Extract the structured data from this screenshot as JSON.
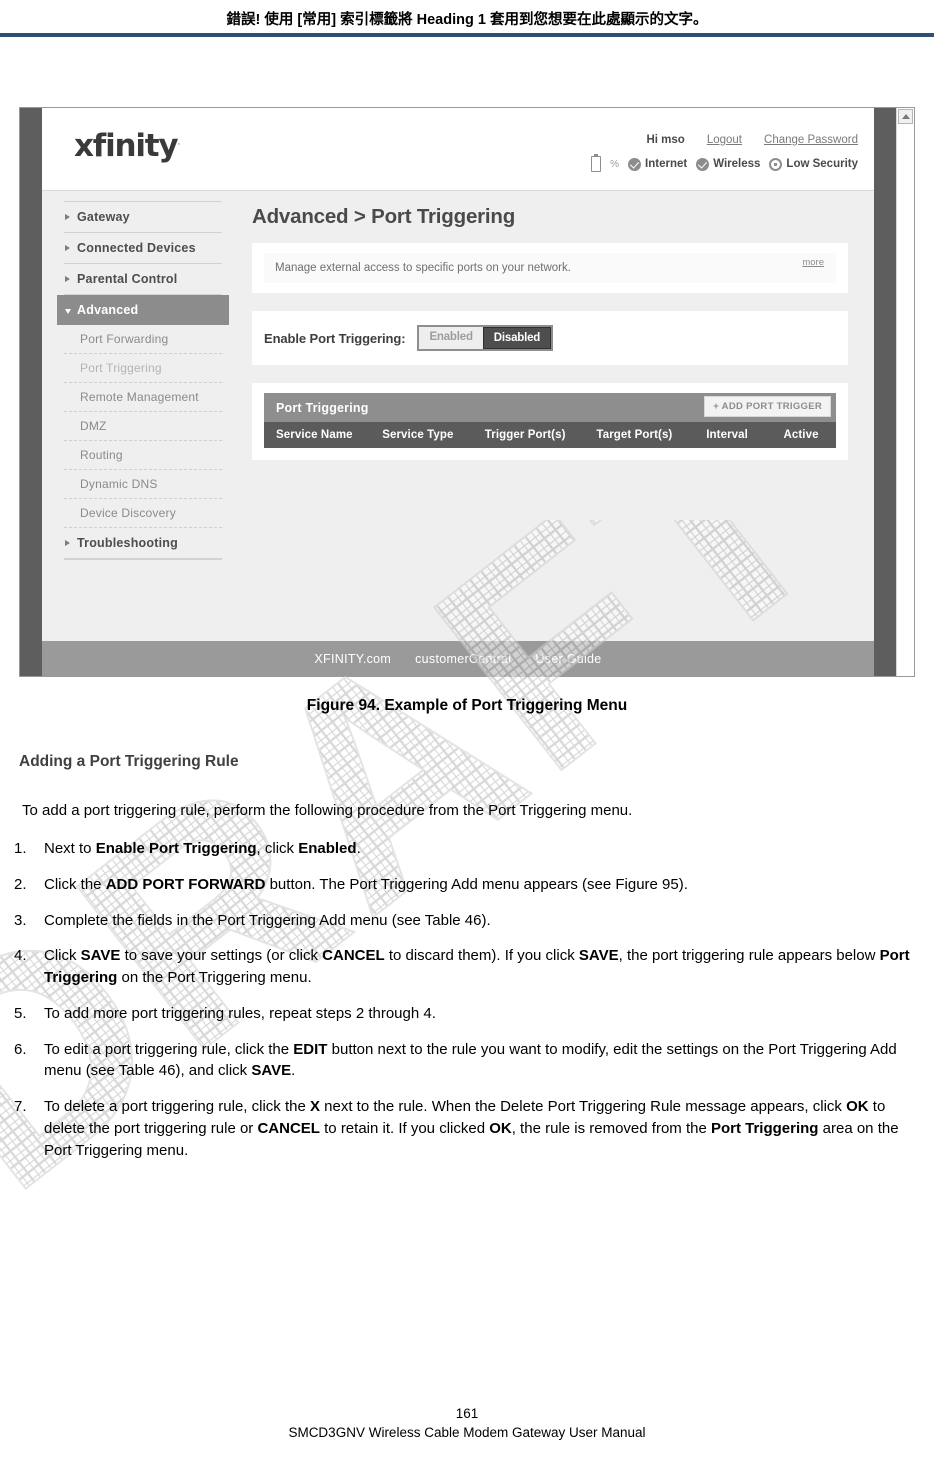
{
  "page_head": {
    "text": "錯誤! 使用 [常用] 索引標籤將 Heading 1 套用到您想要在此處顯示的文字。",
    "rule_color": "#2e5074"
  },
  "watermark": {
    "text": "DRAFT"
  },
  "figure": {
    "caption": "Figure 94. Example of Port Triggering Menu",
    "router_ui": {
      "brand": {
        "logo": "xfinity",
        "tm": "."
      },
      "header": {
        "greeting": "Hi mso",
        "logout": "Logout",
        "change_password": "Change Password",
        "battery_pct": "%",
        "status": [
          {
            "icon": "check-circle-icon",
            "label": "Internet"
          },
          {
            "icon": "check-circle-icon",
            "label": "Wireless"
          },
          {
            "icon": "shield-icon",
            "label": "Low Security"
          }
        ]
      },
      "nav": {
        "items": [
          {
            "label": "Gateway",
            "type": "top",
            "state": "collapsed"
          },
          {
            "label": "Connected Devices",
            "type": "top",
            "state": "collapsed"
          },
          {
            "label": "Parental Control",
            "type": "top",
            "state": "collapsed"
          },
          {
            "label": "Advanced",
            "type": "top",
            "state": "expanded-active"
          },
          {
            "label": "Port Forwarding",
            "type": "sub",
            "state": "normal"
          },
          {
            "label": "Port Triggering",
            "type": "sub",
            "state": "current"
          },
          {
            "label": "Remote Management",
            "type": "sub",
            "state": "normal"
          },
          {
            "label": "DMZ",
            "type": "sub",
            "state": "normal"
          },
          {
            "label": "Routing",
            "type": "sub",
            "state": "normal"
          },
          {
            "label": "Dynamic DNS",
            "type": "sub",
            "state": "normal"
          },
          {
            "label": "Device Discovery",
            "type": "sub",
            "state": "normal"
          },
          {
            "label": "Troubleshooting",
            "type": "top",
            "state": "collapsed"
          }
        ]
      },
      "main": {
        "title": "Advanced > Port Triggering",
        "description": "Manage external access to specific ports on your network.",
        "more_link": "more",
        "toggle": {
          "label": "Enable Port Triggering:",
          "options": [
            "Enabled",
            "Disabled"
          ],
          "selected": "Disabled"
        },
        "table": {
          "title": "Port Triggering",
          "add_button": "+ ADD PORT TRIGGER",
          "columns": [
            "Service Name",
            "Service Type",
            "Trigger Port(s)",
            "Target Port(s)",
            "Interval",
            "Active"
          ],
          "rows": []
        }
      },
      "footer_links": [
        "XFINITY.com",
        "customerCentral",
        "User Guide"
      ],
      "scrollbar": {
        "up_arrow": "scroll-up-icon"
      }
    }
  },
  "section": {
    "heading": "Adding a Port Triggering Rule",
    "intro": "To add a port triggering rule, perform the following procedure from the Port Triggering menu."
  },
  "steps": [
    {
      "parts": [
        {
          "t": "Next to ",
          "b": false
        },
        {
          "t": "Enable Port Triggering",
          "b": true
        },
        {
          "t": ", click ",
          "b": false
        },
        {
          "t": "Enabled",
          "b": true
        },
        {
          "t": ".",
          "b": false
        }
      ]
    },
    {
      "parts": [
        {
          "t": "Click the ",
          "b": false
        },
        {
          "t": "ADD PORT FORWARD",
          "b": true
        },
        {
          "t": " button. The Port Triggering Add menu appears (see Figure 95).",
          "b": false
        }
      ]
    },
    {
      "parts": [
        {
          "t": "Complete the fields in the Port Triggering Add menu (see Table 46).",
          "b": false
        }
      ]
    },
    {
      "parts": [
        {
          "t": "Click ",
          "b": false
        },
        {
          "t": "SAVE",
          "b": true
        },
        {
          "t": " to save your settings (or click ",
          "b": false
        },
        {
          "t": "CANCEL",
          "b": true
        },
        {
          "t": " to discard them). If you click ",
          "b": false
        },
        {
          "t": "SAVE",
          "b": true
        },
        {
          "t": ", the port triggering rule appears below ",
          "b": false
        },
        {
          "t": "Port Triggering",
          "b": true
        },
        {
          "t": " on the Port Triggering menu.",
          "b": false
        }
      ]
    },
    {
      "parts": [
        {
          "t": "To add more port triggering rules, repeat steps 2 through 4.",
          "b": false
        }
      ]
    },
    {
      "parts": [
        {
          "t": "To edit a port triggering rule, click the ",
          "b": false
        },
        {
          "t": "EDIT",
          "b": true
        },
        {
          "t": " button next to the rule you want to modify, edit the settings on the Port Triggering Add menu (see Table 46), and click ",
          "b": false
        },
        {
          "t": "SAVE",
          "b": true
        },
        {
          "t": ".",
          "b": false
        }
      ]
    },
    {
      "parts": [
        {
          "t": "To delete a port triggering rule, click the ",
          "b": false
        },
        {
          "t": "X",
          "b": true
        },
        {
          "t": " next to the rule. When the Delete Port Triggering Rule message appears, click ",
          "b": false
        },
        {
          "t": "OK",
          "b": true
        },
        {
          "t": " to delete the port triggering rule or ",
          "b": false
        },
        {
          "t": "CANCEL",
          "b": true
        },
        {
          "t": " to retain it. If you clicked ",
          "b": false
        },
        {
          "t": "OK",
          "b": true
        },
        {
          "t": ", the rule is removed from the ",
          "b": false
        },
        {
          "t": "Port Triggering",
          "b": true
        },
        {
          "t": " area on the Port Triggering menu.",
          "b": false
        }
      ]
    }
  ],
  "doc_footer": {
    "page_number": "161",
    "manual_title": "SMCD3GNV Wireless Cable Modem Gateway User Manual"
  }
}
